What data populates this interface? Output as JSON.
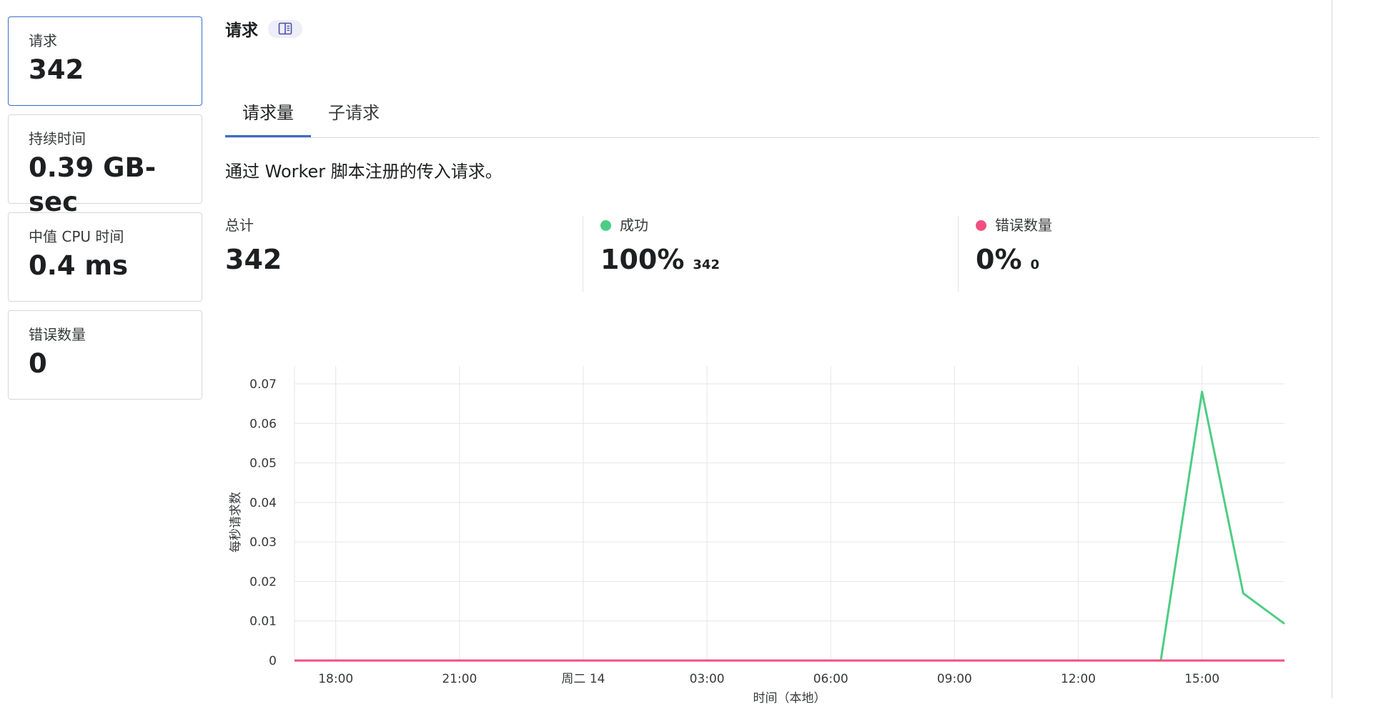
{
  "sidebar": {
    "cards": [
      {
        "label": "请求",
        "value": "342"
      },
      {
        "label": "持续时间",
        "value": "0.39 GB-sec"
      },
      {
        "label": "中值 CPU 时间",
        "value": "0.4 ms"
      },
      {
        "label": "错误数量",
        "value": "0"
      }
    ]
  },
  "main": {
    "title": "请求",
    "tabs": [
      {
        "label": "请求量"
      },
      {
        "label": "子请求"
      }
    ],
    "description": "通过 Worker 脚本注册的传入请求。",
    "metrics": [
      {
        "label": "总计",
        "value": "342",
        "sub": ""
      },
      {
        "label": "成功",
        "value": "100%",
        "sub": "342"
      },
      {
        "label": "错误数量",
        "value": "0%",
        "sub": "0"
      }
    ]
  },
  "colors": {
    "accent": "#3c6cc9",
    "success": "#4dcd84",
    "error": "#f0507f"
  },
  "icons": {
    "docs": "book-icon"
  },
  "chart_data": {
    "type": "line",
    "ylabel": "每秒请求数",
    "xlabel": "时间（本地）",
    "ylim": [
      0,
      0.07
    ],
    "yticks": [
      "0",
      "0.01",
      "0.02",
      "0.03",
      "0.04",
      "0.05",
      "0.06",
      "0.07"
    ],
    "xticks": [
      "18:00",
      "21:00",
      "周二 14",
      "03:00",
      "06:00",
      "09:00",
      "12:00",
      "15:00"
    ],
    "x_range_hours": [
      17,
      41
    ],
    "series": [
      {
        "name": "成功",
        "color": "#4dcd84",
        "points": [
          [
            17,
            0
          ],
          [
            38,
            0
          ],
          [
            39,
            0.068
          ],
          [
            40,
            0.017
          ],
          [
            41,
            0.0093
          ]
        ]
      },
      {
        "name": "错误数量",
        "color": "#f0507f",
        "points": [
          [
            17,
            0
          ],
          [
            41,
            0
          ]
        ]
      }
    ]
  }
}
